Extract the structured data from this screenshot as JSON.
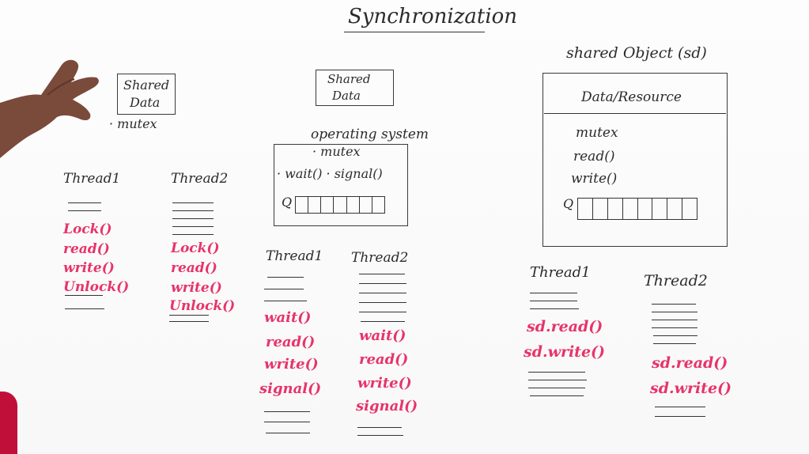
{
  "title": "Synchronization",
  "panel1": {
    "box_label_line1": "Shared",
    "box_label_line2": "Data",
    "bullet": "· mutex",
    "thread1": {
      "name": "Thread1",
      "calls": [
        "Lock()",
        "read()",
        "write()",
        "Unlock()"
      ]
    },
    "thread2": {
      "name": "Thread2",
      "calls": [
        "Lock()",
        "read()",
        "write()",
        "Unlock()"
      ]
    }
  },
  "panel2": {
    "box_label_line1": "Shared",
    "box_label_line2": "Data",
    "os_label": "operating system",
    "os_bullet": "· mutex",
    "os_methods": "· wait() · signal()",
    "queue_label": "Q",
    "thread1": {
      "name": "Thread1",
      "calls": [
        "wait()",
        "read()",
        "write()",
        "signal()"
      ]
    },
    "thread2": {
      "name": "Thread2",
      "calls": [
        "wait()",
        "read()",
        "write()",
        "signal()"
      ]
    }
  },
  "panel3": {
    "object_label": "shared Object (sd)",
    "header": "Data/Resource",
    "members": [
      "mutex",
      "read()",
      "write()"
    ],
    "queue_label": "Q",
    "thread1": {
      "name": "Thread1",
      "calls": [
        "sd.read()",
        "sd.write()"
      ]
    },
    "thread2": {
      "name": "Thread2",
      "calls": [
        "sd.read()",
        "sd.write()"
      ]
    }
  }
}
